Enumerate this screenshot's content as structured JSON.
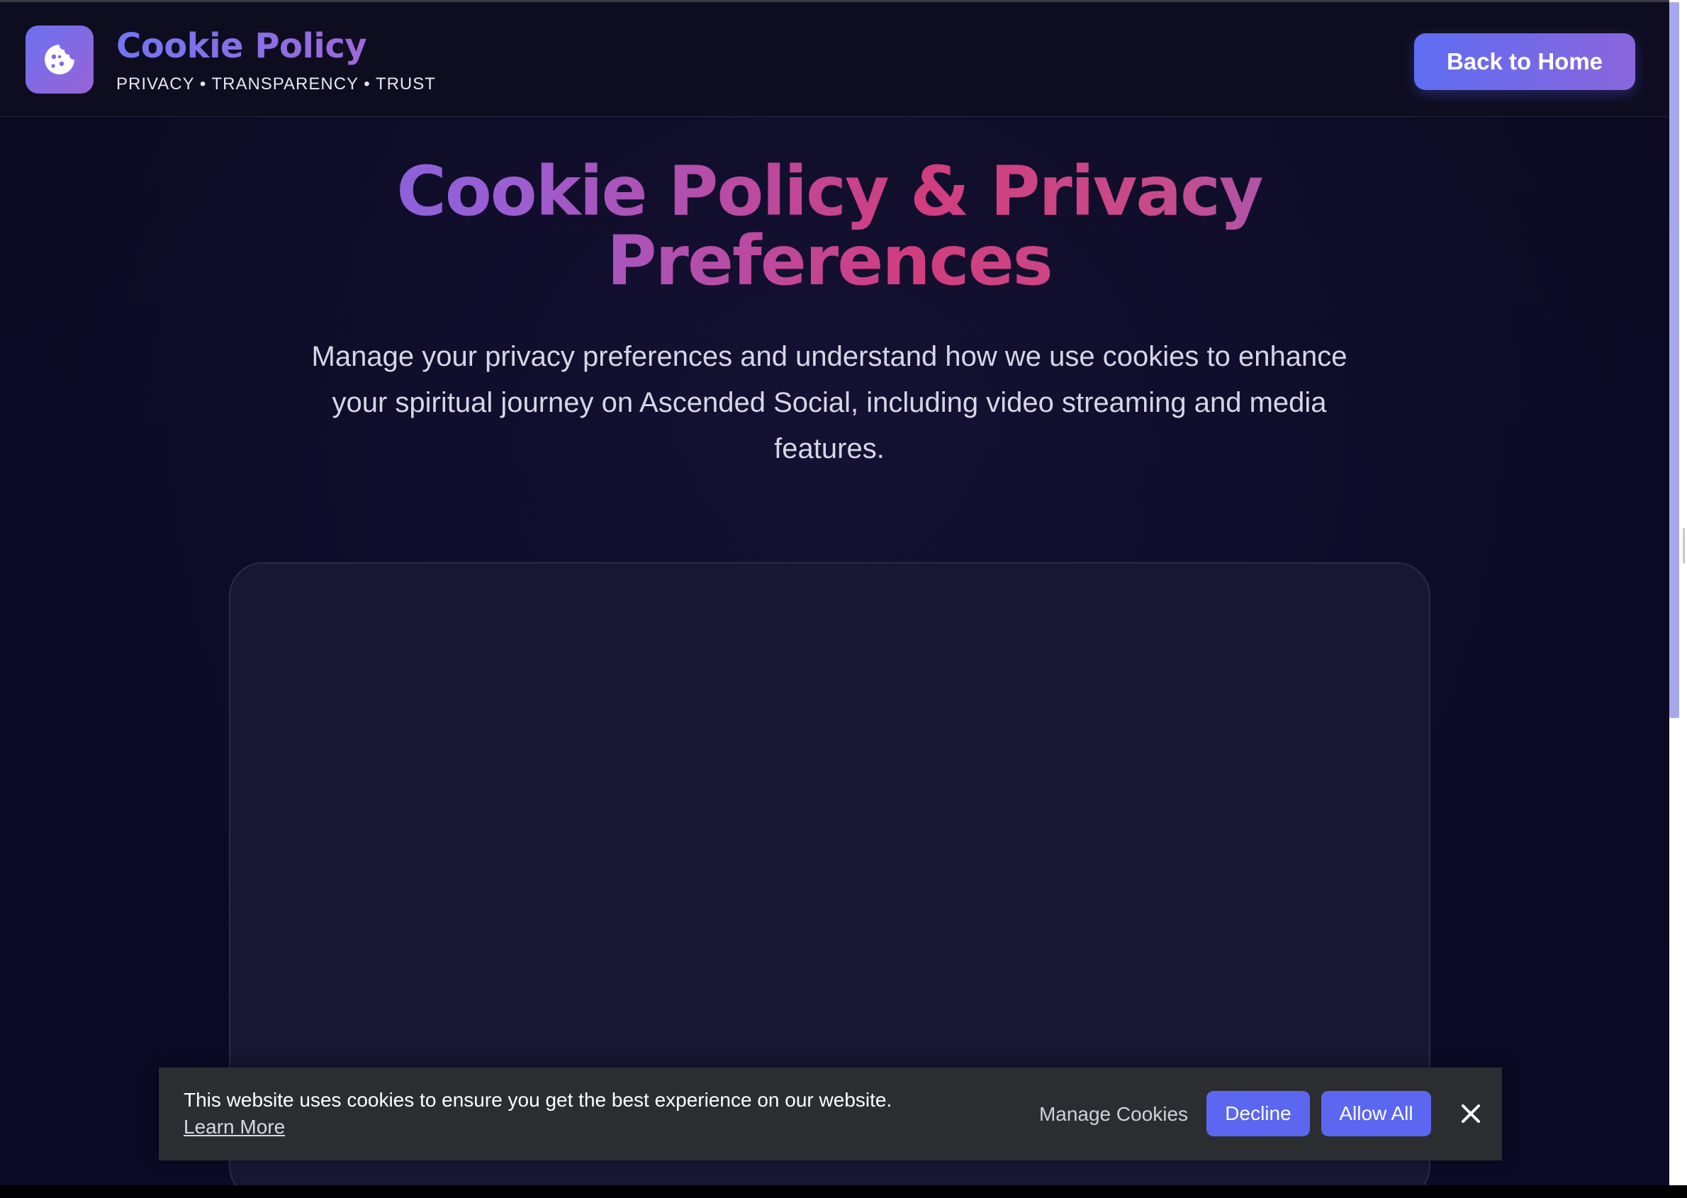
{
  "header": {
    "brand_title": "Cookie Policy",
    "tagline": "PRIVACY • TRANSPARENCY • TRUST",
    "logo_icon": "cookie-icon",
    "home_button_label": "Back to Home"
  },
  "hero": {
    "title_line1": "Cookie Policy & Privacy",
    "title_line2": "Preferences",
    "subtitle": "Manage your privacy preferences and understand how we use cookies to enhance your spiritual journey on Ascended Social, including video streaming and media features."
  },
  "cookie_banner": {
    "message": "This website uses cookies to ensure you get the best experience on our website.",
    "learn_more": "Learn More",
    "manage_label": "Manage Cookies",
    "decline_label": "Decline",
    "allow_label": "Allow All",
    "close_icon": "close-icon"
  },
  "colors": {
    "accent": "#5b67f0",
    "accent_purple": "#9a62d6",
    "highlight_pink": "#d13d7e",
    "background": "#0c0b22",
    "card": "#171733",
    "banner": "#2c2d31"
  }
}
